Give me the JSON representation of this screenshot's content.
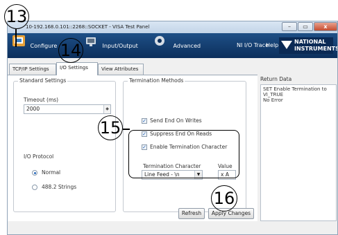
{
  "window": {
    "title": "10-192.168.0.101::2268::SOCKET - VISA Test Panel",
    "buttons": {
      "minimize": "–",
      "maximize": "▭",
      "close": "x"
    }
  },
  "toolbar": {
    "configure_label": "Configure",
    "io_label": "Input/Output",
    "advanced_label": "Advanced",
    "nio_trace_label": "NI I/O Trace",
    "help_label": "Help",
    "brand_line1": "NATIONAL",
    "brand_line2": "INSTRUMENTS"
  },
  "tabs": [
    "TCP/IP Settings",
    "I/O Settings",
    "View Attributes"
  ],
  "standard_settings": {
    "title": "Standard Settings",
    "timeout_label": "Timeout (ms)",
    "timeout_value": "2000",
    "protocol_label": "I/O Protocol",
    "normal_label": "Normal",
    "strings_label": "488.2 Strings",
    "selected_protocol": "Normal"
  },
  "termination_methods": {
    "title": "Termination Methods",
    "send_end_label": "Send End On Writes",
    "suppress_end_label": "Suppress End On Reads",
    "enable_term_label": "Enable Termination Character",
    "term_char_label": "Termination Character",
    "value_label": "Value",
    "term_char_value": "Line Feed - \\n",
    "value_value": "x A"
  },
  "buttons": {
    "refresh": "Refresh",
    "apply": "Apply Changes"
  },
  "return_data": {
    "title": "Return Data",
    "lines": [
      "SET Enable Termination to",
      "VI_TRUE",
      "No Error"
    ]
  },
  "callouts": {
    "c13": "13",
    "c14": "14",
    "c15": "15",
    "c16": "16"
  },
  "colors": {
    "toolbar": "#0c2f5c",
    "accent": "#2a6bbd"
  }
}
